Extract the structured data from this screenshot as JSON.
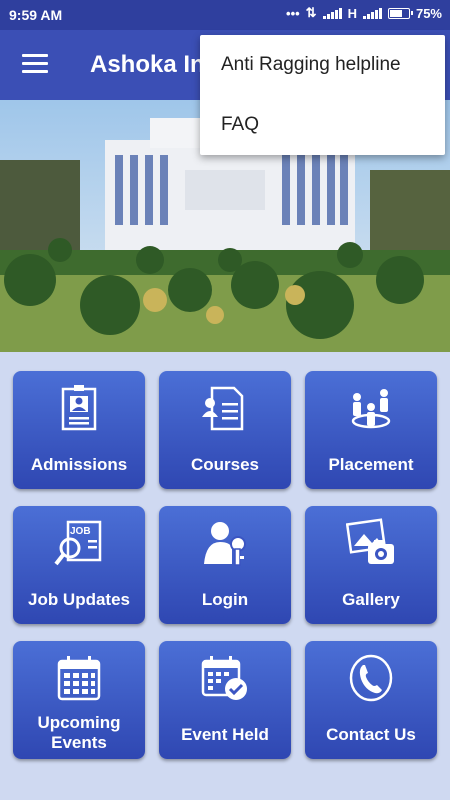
{
  "status": {
    "time": "9:59 AM",
    "dots": "•••",
    "network": "H",
    "battery": "75%",
    "battery_level": 0.75
  },
  "app_bar": {
    "title": "Ashoka Institute"
  },
  "overflow_menu": {
    "items": [
      "Anti Ragging helpline",
      "FAQ"
    ]
  },
  "tiles": [
    {
      "label": "Admissions",
      "icon": "id-card-icon"
    },
    {
      "label": "Courses",
      "icon": "document-person-icon"
    },
    {
      "label": "Placement",
      "icon": "people-network-icon"
    },
    {
      "label": "Job Updates",
      "icon": "job-search-icon"
    },
    {
      "label": "Login",
      "icon": "user-key-icon"
    },
    {
      "label": "Gallery",
      "icon": "camera-picture-icon"
    },
    {
      "label": "Upcoming Events",
      "label_line1": "Upcoming",
      "label_line2": "Events",
      "icon": "calendar-icon"
    },
    {
      "label": "Event Held",
      "icon": "calendar-check-icon"
    },
    {
      "label": "Contact Us",
      "icon": "phone-icon"
    }
  ],
  "colors": {
    "status_bar": "#2f3f9e",
    "app_bar": "#3b4fb5",
    "tile_top": "#4b6fd6",
    "tile_bottom": "#2f47b2",
    "background": "#cfd9f1"
  }
}
